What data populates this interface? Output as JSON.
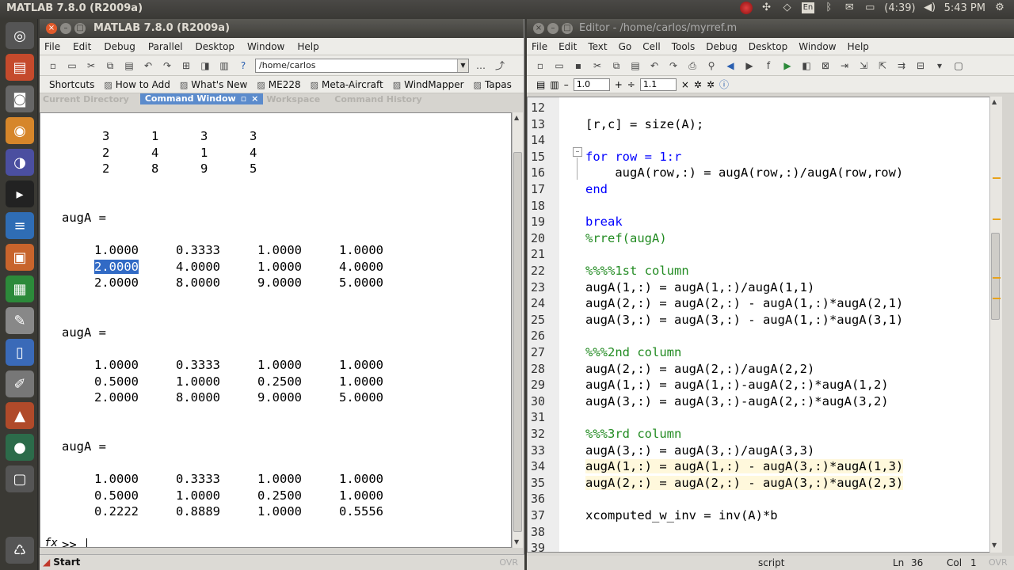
{
  "top_panel": {
    "app_title": "MATLAB  7.8.0 (R2009a)",
    "keyboard_layout": "En",
    "battery": "(4:39)",
    "clock": "5:43 PM"
  },
  "matlab": {
    "title": "MATLAB  7.8.0 (R2009a)",
    "menu": [
      "File",
      "Edit",
      "Debug",
      "Parallel",
      "Desktop",
      "Window",
      "Help"
    ],
    "current_path": "/home/carlos",
    "shortcuts": [
      "Shortcuts",
      "How to Add",
      "What's New",
      "ME228",
      "Meta-Aircraft",
      "WindMapper",
      "Tapas"
    ],
    "tabs": {
      "current_directory": "Current Directory",
      "command_window": "Command Window",
      "workspace": "Workspace",
      "command_history": "Command History"
    },
    "output": {
      "matrix_top": [
        [
          "3",
          "1",
          "3",
          "3"
        ],
        [
          "2",
          "4",
          "1",
          "4"
        ],
        [
          "2",
          "8",
          "9",
          "5"
        ]
      ],
      "label1": "augA =",
      "matrix1": [
        [
          "1.0000",
          "0.3333",
          "1.0000",
          "1.0000"
        ],
        [
          "2.0000",
          "4.0000",
          "1.0000",
          "4.0000"
        ],
        [
          "2.0000",
          "8.0000",
          "9.0000",
          "5.0000"
        ]
      ],
      "label2": "augA =",
      "matrix2": [
        [
          "1.0000",
          "0.3333",
          "1.0000",
          "1.0000"
        ],
        [
          "0.5000",
          "1.0000",
          "0.2500",
          "1.0000"
        ],
        [
          "2.0000",
          "8.0000",
          "9.0000",
          "5.0000"
        ]
      ],
      "label3": "augA =",
      "matrix3": [
        [
          "1.0000",
          "0.3333",
          "1.0000",
          "1.0000"
        ],
        [
          "0.5000",
          "1.0000",
          "0.2500",
          "1.0000"
        ],
        [
          "0.2222",
          "0.8889",
          "1.0000",
          "0.5556"
        ]
      ]
    },
    "prompt_fx": "fx",
    "prompt": ">>",
    "start_label": "Start",
    "ovr": "OVR"
  },
  "editor": {
    "title": "Editor - /home/carlos/myrref.m",
    "menu": [
      "File",
      "Edit",
      "Text",
      "Go",
      "Cell",
      "Tools",
      "Debug",
      "Desktop",
      "Window",
      "Help"
    ],
    "cell_spacing_1": "1.0",
    "cell_spacing_2": "1.1",
    "lines": [
      {
        "n": "12",
        "text": "",
        "kind": "code"
      },
      {
        "n": "13",
        "text": "[r,c] = size(A);",
        "kind": "code"
      },
      {
        "n": "14",
        "text": "",
        "kind": "code"
      },
      {
        "n": "15",
        "text": "for row = 1:r",
        "kind": "kw"
      },
      {
        "n": "16",
        "text": "    augA(row,:) = augA(row,:)/augA(row,row)",
        "kind": "code"
      },
      {
        "n": "17",
        "text": "end",
        "kind": "kw"
      },
      {
        "n": "18",
        "text": "",
        "kind": "code"
      },
      {
        "n": "19",
        "text": "break",
        "kind": "kw"
      },
      {
        "n": "20",
        "text": "%rref(augA)",
        "kind": "cm"
      },
      {
        "n": "21",
        "text": "",
        "kind": "code"
      },
      {
        "n": "22",
        "text": "%%%%1st column",
        "kind": "cm"
      },
      {
        "n": "23",
        "text": "augA(1,:) = augA(1,:)/augA(1,1)",
        "kind": "code"
      },
      {
        "n": "24",
        "text": "augA(2,:) = augA(2,:) - augA(1,:)*augA(2,1)",
        "kind": "code"
      },
      {
        "n": "25",
        "text": "augA(3,:) = augA(3,:) - augA(1,:)*augA(3,1)",
        "kind": "code"
      },
      {
        "n": "26",
        "text": "",
        "kind": "code"
      },
      {
        "n": "27",
        "text": "%%%2nd column",
        "kind": "cm"
      },
      {
        "n": "28",
        "text": "augA(2,:) = augA(2,:)/augA(2,2)",
        "kind": "code"
      },
      {
        "n": "29",
        "text": "augA(1,:) = augA(1,:)-augA(2,:)*augA(1,2)",
        "kind": "code"
      },
      {
        "n": "30",
        "text": "augA(3,:) = augA(3,:)-augA(2,:)*augA(3,2)",
        "kind": "code"
      },
      {
        "n": "31",
        "text": "",
        "kind": "code"
      },
      {
        "n": "32",
        "text": "%%%3rd column",
        "kind": "cm"
      },
      {
        "n": "33",
        "text": "augA(3,:) = augA(3,:)/augA(3,3)",
        "kind": "code"
      },
      {
        "n": "34",
        "text": "augA(1,:) = augA(1,:) - augA(3,:)*augA(1,3)",
        "kind": "hl"
      },
      {
        "n": "35",
        "text": "augA(2,:) = augA(2,:) - augA(3,:)*augA(2,3)",
        "kind": "hl"
      },
      {
        "n": "36",
        "text": "",
        "kind": "code"
      },
      {
        "n": "37",
        "text": "xcomputed_w_inv = inv(A)*b",
        "kind": "code"
      },
      {
        "n": "38",
        "text": "",
        "kind": "code"
      },
      {
        "n": "39",
        "text": "",
        "kind": "code"
      }
    ],
    "status": {
      "mode": "script",
      "ln_label": "Ln",
      "ln": "36",
      "col_label": "Col",
      "col": "1",
      "ovr": "OVR"
    }
  },
  "colors": {
    "keyword": "#0000ff",
    "comment": "#228b22",
    "selection": "#316ac5",
    "active_tab": "#5b8bcc"
  }
}
